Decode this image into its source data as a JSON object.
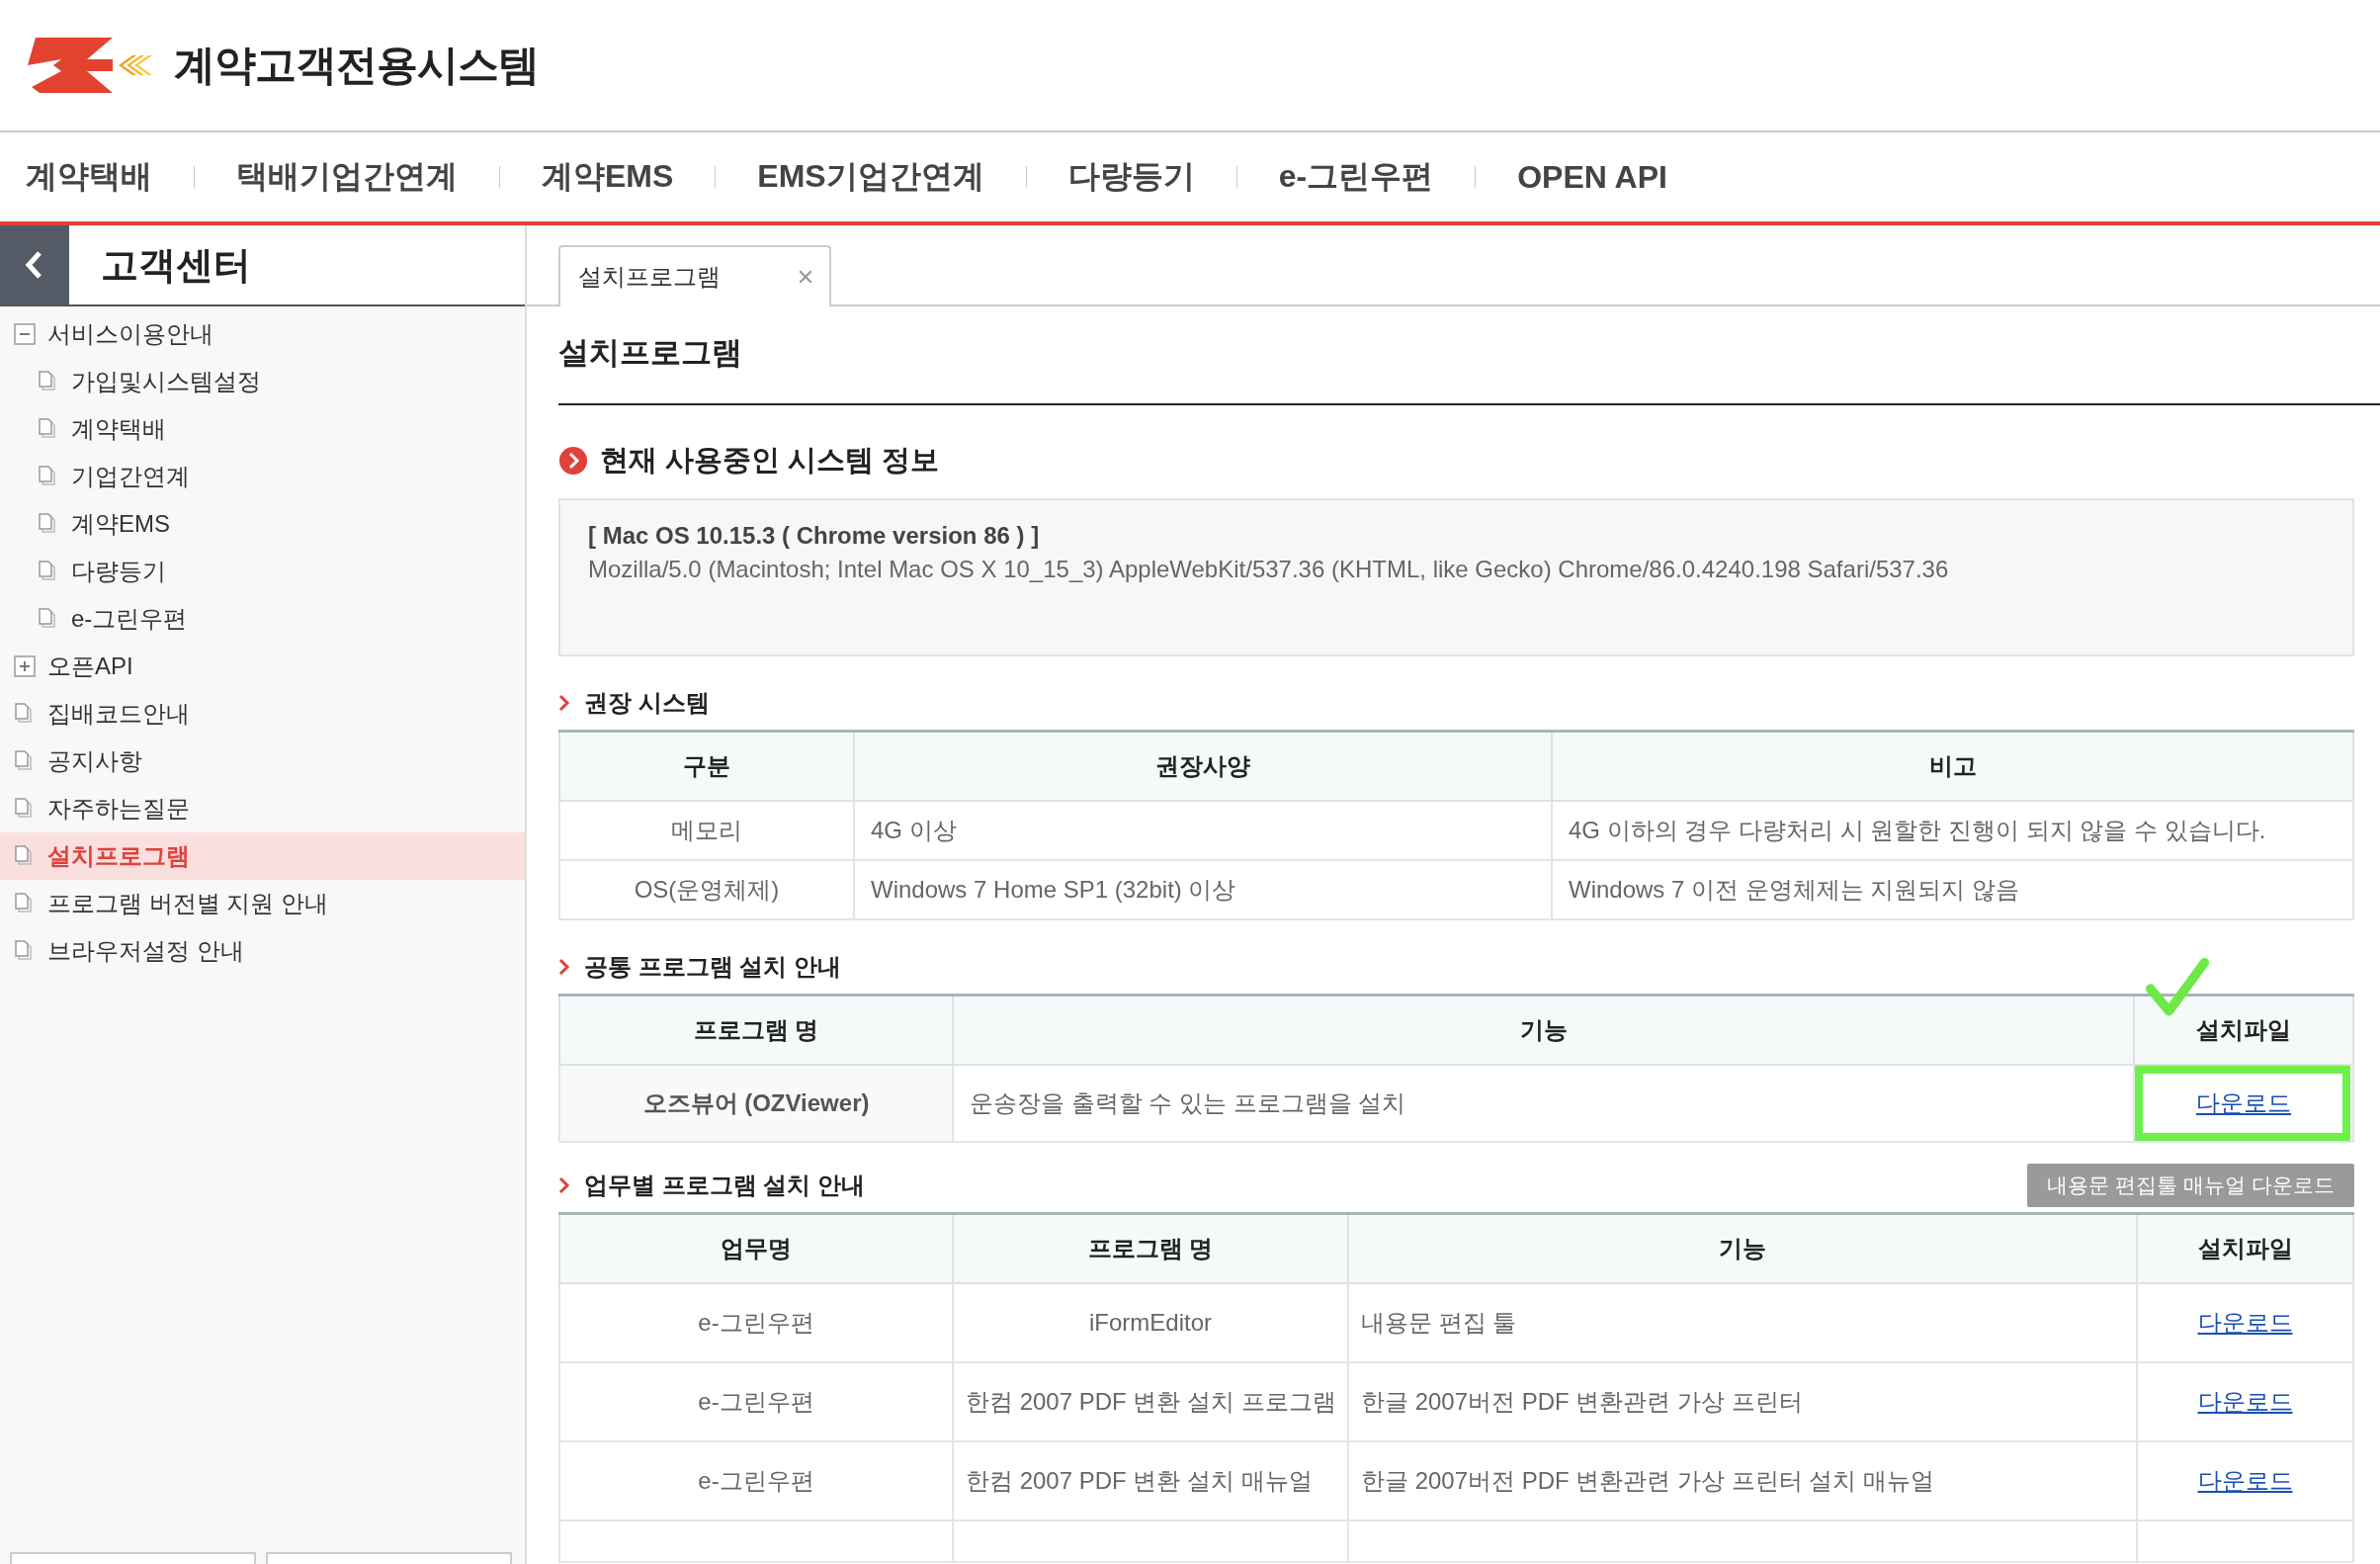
{
  "header": {
    "logo_text": "계약고객전용시스템"
  },
  "nav": [
    "계약택배",
    "택배기업간연계",
    "계약EMS",
    "EMS기업간연계",
    "다량등기",
    "e-그린우편",
    "OPEN API"
  ],
  "sidebar": {
    "title": "고객센터",
    "items": [
      {
        "label": "서비스이용안내",
        "kind": "folder",
        "expanded": true,
        "selected": false,
        "children": [
          {
            "label": "가입및시스템설정",
            "kind": "page",
            "selected": false
          },
          {
            "label": "계약택배",
            "kind": "page",
            "selected": false
          },
          {
            "label": "기업간연계",
            "kind": "page",
            "selected": false
          },
          {
            "label": "계약EMS",
            "kind": "page",
            "selected": false
          },
          {
            "label": "다량등기",
            "kind": "page",
            "selected": false
          },
          {
            "label": "e-그린우편",
            "kind": "page",
            "selected": false
          }
        ]
      },
      {
        "label": "오픈API",
        "kind": "folder",
        "expanded": false,
        "selected": false
      },
      {
        "label": "집배코드안내",
        "kind": "page",
        "selected": false
      },
      {
        "label": "공지사항",
        "kind": "page",
        "selected": false
      },
      {
        "label": "자주하는질문",
        "kind": "page",
        "selected": false
      },
      {
        "label": "설치프로그램",
        "kind": "page",
        "selected": true
      },
      {
        "label": "프로그램 버전별 지원 안내",
        "kind": "page",
        "selected": false
      },
      {
        "label": "브라우저설정 안내",
        "kind": "page",
        "selected": false
      }
    ]
  },
  "tabs": [
    {
      "label": "설치프로그램",
      "selected": true
    }
  ],
  "page_title": "설치프로그램",
  "system_info": {
    "heading": "현재 사용중인 시스템 정보",
    "summary": "[ Mac OS 10.15.3 ( Chrome version 86 ) ]",
    "user_agent": "Mozilla/5.0 (Macintosh; Intel Mac OS X 10_15_3) AppleWebKit/537.36 (KHTML, like Gecko) Chrome/86.0.4240.198 Safari/537.36"
  },
  "recommended": {
    "heading": "권장 시스템",
    "columns": [
      "구분",
      "권장사양",
      "비고"
    ],
    "rows": [
      [
        "메모리",
        "4G 이상",
        "4G 이하의 경우 다량처리 시 원할한 진행이 되지 않을 수 있습니다."
      ],
      [
        "OS(운영체제)",
        "Windows 7 Home SP1 (32bit) 이상",
        "Windows 7 이전 운영체제는 지원되지 않음"
      ]
    ]
  },
  "common": {
    "heading": "공통 프로그램 설치 안내",
    "columns": [
      "프로그램 명",
      "기능",
      "설치파일"
    ],
    "rows": [
      {
        "name": "오즈뷰어 (OZViewer)",
        "function": "운송장을 출력할 수 있는 프로그램을 설치",
        "link": "다운로드",
        "highlighted": true
      }
    ]
  },
  "by_task": {
    "heading": "업무별 프로그램 설치 안내",
    "button": "내용문 편집툴 매뉴얼 다운로드",
    "columns": [
      "업무명",
      "프로그램 명",
      "기능",
      "설치파일"
    ],
    "rows": [
      {
        "task": "e-그린우편",
        "program": "iFormEditor",
        "function": "내용문 편집 툴",
        "link": "다운로드"
      },
      {
        "task": "e-그린우편",
        "program": "한컴 2007 PDF 변환 설치 프로그램",
        "function": "한글 2007버전 PDF 변환관련 가상 프린터",
        "link": "다운로드"
      },
      {
        "task": "e-그린우편",
        "program": "한컴 2007 PDF 변환 설치 매뉴얼",
        "function": "한글 2007버전 PDF 변환관련 가상 프린터 설치 매뉴얼",
        "link": "다운로드"
      }
    ]
  }
}
